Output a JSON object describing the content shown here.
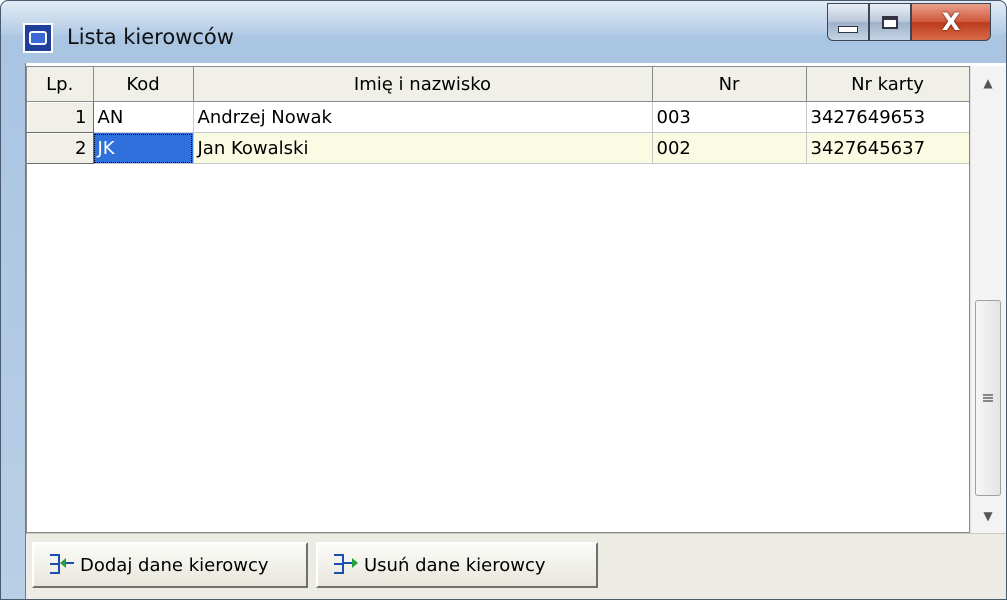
{
  "window": {
    "title": "Lista kierowców",
    "icon": "app-icon",
    "controls": {
      "minimize": "minimize-icon",
      "maximize": "maximize-icon",
      "close_label": "X"
    }
  },
  "grid": {
    "columns": [
      "Lp.",
      "Kod",
      "Imię i nazwisko",
      "Nr",
      "Nr karty"
    ],
    "rows": [
      {
        "lp": "1",
        "kod": "AN",
        "name": "Andrzej Nowak",
        "nr": "003",
        "karta": "3427649653"
      },
      {
        "lp": "2",
        "kod": "JK",
        "name": "Jan Kowalski",
        "nr": "002",
        "karta": "3427645637"
      }
    ],
    "selected_row": 2,
    "focused_column": "Kod"
  },
  "buttons": {
    "add_label": "Dodaj dane kierowcy",
    "delete_label": "Usuń dane kierowcy"
  },
  "colors": {
    "selection": "#2f70dd",
    "selected_row_bg": "#fbfbe3",
    "header_bg": "#f0efe8",
    "icon_blue": "#1a4fb0",
    "icon_green": "#27a03a"
  }
}
